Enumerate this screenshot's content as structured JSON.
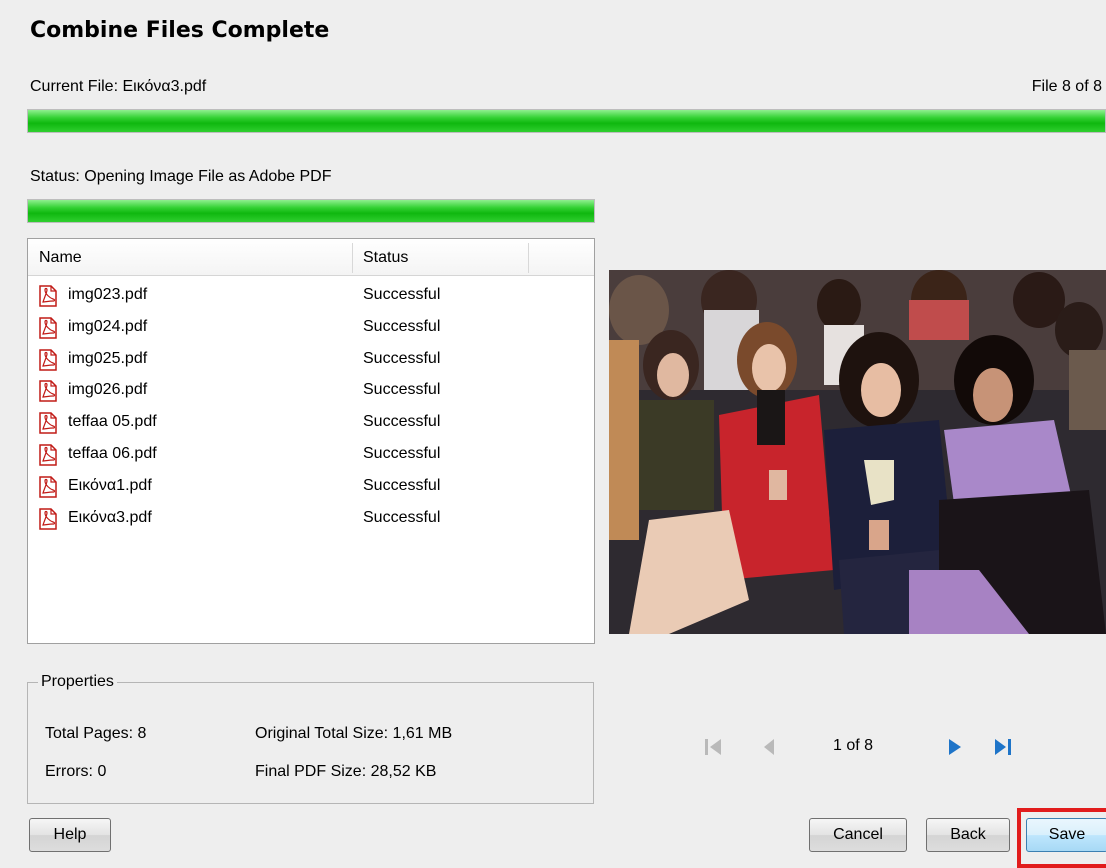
{
  "header": {
    "title": "Combine Files Complete"
  },
  "current": {
    "label": "Current File: Εικόνα3.pdf",
    "counter": "File 8 of 8",
    "progress": 1.0
  },
  "status": {
    "label": "Status: Opening Image File as Adobe PDF",
    "progress": 1.0
  },
  "list": {
    "columns": [
      "Name",
      "Status"
    ],
    "rows": [
      {
        "name": "img023.pdf",
        "status": "Successful"
      },
      {
        "name": "img024.pdf",
        "status": "Successful"
      },
      {
        "name": "img025.pdf",
        "status": "Successful"
      },
      {
        "name": "img026.pdf",
        "status": "Successful"
      },
      {
        "name": "teffaa 05.pdf",
        "status": "Successful"
      },
      {
        "name": "teffaa 06.pdf",
        "status": "Successful"
      },
      {
        "name": "Εικόνα1.pdf",
        "status": "Successful"
      },
      {
        "name": "Εικόνα3.pdf",
        "status": "Successful"
      }
    ]
  },
  "properties": {
    "legend": "Properties",
    "total_pages": "Total Pages: 8",
    "errors": "Errors: 0",
    "original_size": "Original Total Size: 1,61 MB",
    "final_size": "Final PDF Size: 28,52 KB"
  },
  "preview": {
    "page_indicator": "1 of 8",
    "icons": [
      "first-page-icon",
      "prev-page-icon",
      "next-page-icon",
      "last-page-icon"
    ]
  },
  "buttons": {
    "help": "Help",
    "cancel": "Cancel",
    "back": "Back",
    "save": "Save"
  },
  "colors": {
    "progress": "#19c219",
    "highlight": "#e11c1c",
    "nav_active": "#1e74c8",
    "nav_disabled": "#b9b9b9"
  }
}
